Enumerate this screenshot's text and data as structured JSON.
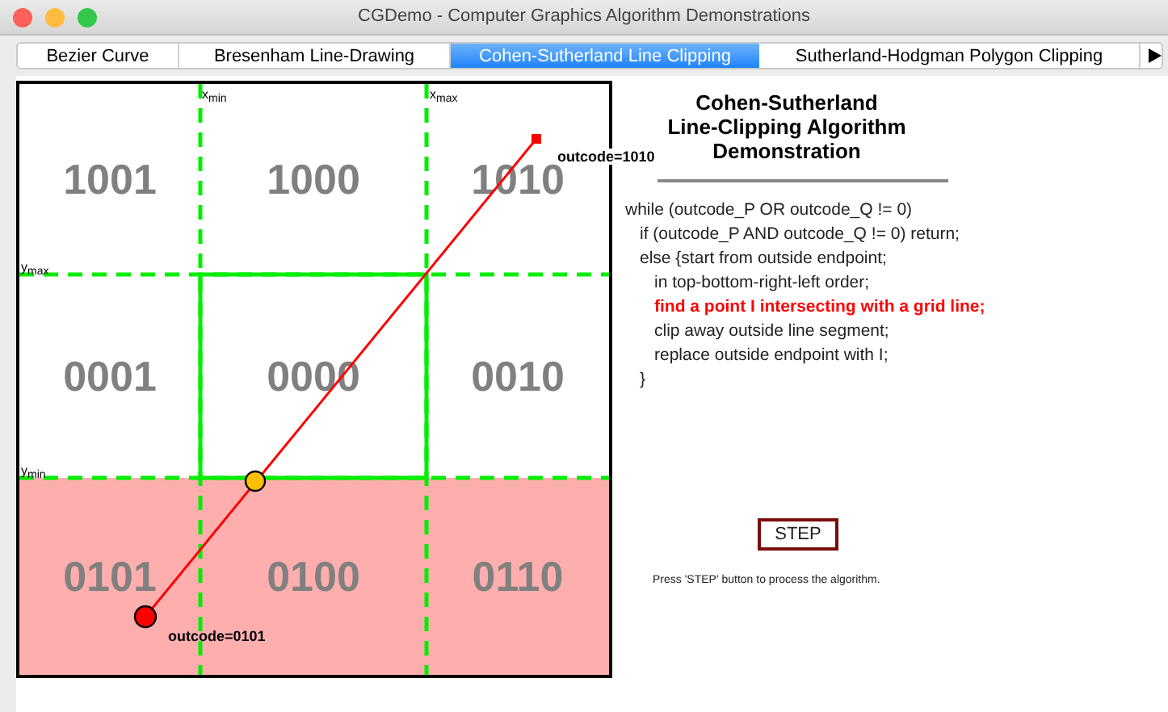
{
  "window": {
    "title": "CGDemo - Computer Graphics Algorithm Demonstrations"
  },
  "tabs": [
    {
      "label": "Bezier Curve",
      "selected": false
    },
    {
      "label": "Bresenham Line-Drawing",
      "selected": false
    },
    {
      "label": "Cohen-Sutherland Line Clipping",
      "selected": true
    },
    {
      "label": "Sutherland-Hodgman Polygon Clipping",
      "selected": false
    }
  ],
  "canvas": {
    "regions": [
      {
        "code": "1001",
        "highlighted": false
      },
      {
        "code": "1000",
        "highlighted": false
      },
      {
        "code": "1010",
        "highlighted": false
      },
      {
        "code": "0001",
        "highlighted": false
      },
      {
        "code": "0000",
        "highlighted": false
      },
      {
        "code": "0010",
        "highlighted": false
      },
      {
        "code": "0101",
        "highlighted": true
      },
      {
        "code": "0100",
        "highlighted": true
      },
      {
        "code": "0110",
        "highlighted": true
      }
    ],
    "grid_labels": [
      {
        "var": "x",
        "sub": "min"
      },
      {
        "var": "x",
        "sub": "max"
      },
      {
        "var": "y",
        "sub": "max"
      },
      {
        "var": "y",
        "sub": "min"
      }
    ],
    "endpoints": [
      {
        "label": "outcode=1010",
        "kind": "square"
      },
      {
        "label": "outcode=0101",
        "kind": "circle"
      }
    ]
  },
  "panel": {
    "title": [
      "Cohen-Sutherland",
      "Line-Clipping Algorithm",
      "Demonstration"
    ],
    "code": [
      {
        "text": "while (outcode_P OR outcode_Q != 0)",
        "highlighted": false,
        "children": [
          {
            "text": "if (outcode_P AND outcode_Q != 0) return;",
            "highlighted": false
          },
          {
            "text": "else {start from outside endpoint;",
            "highlighted": false,
            "children": [
              {
                "text": "in top-bottom-right-left order;",
                "highlighted": false
              },
              {
                "text": "find a point I intersecting with a grid line;",
                "highlighted": true
              },
              {
                "text": "clip away outside line segment;",
                "highlighted": false
              },
              {
                "text": "replace outside endpoint with I;",
                "highlighted": false
              }
            ]
          },
          {
            "text": "}",
            "highlighted": false
          }
        ]
      }
    ],
    "button": "STEP",
    "hint": "Press 'STEP' button to process the algorithm."
  }
}
